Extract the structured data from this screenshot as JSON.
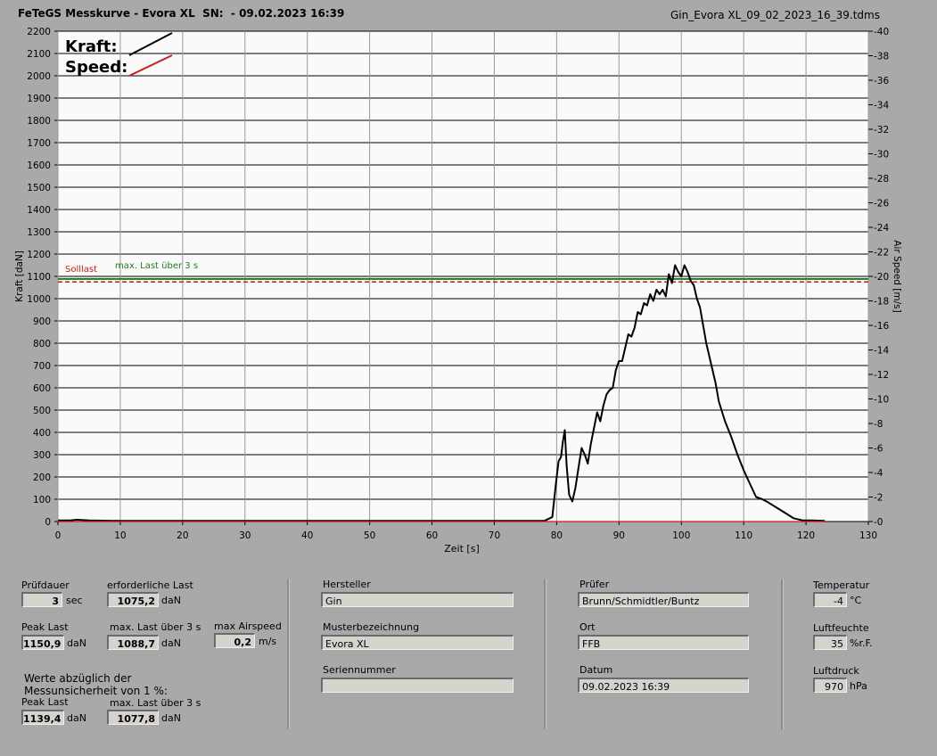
{
  "header": {
    "title": "FeTeGS Messkurve - Evora XL  SN:  - 09.02.2023 16:39",
    "filename": "Gin_Evora XL_09_02_2023_16_39.tdms"
  },
  "chart_data": {
    "type": "line",
    "xlabel": "Zeit [s]",
    "ylabel": "Kraft [daN]",
    "y2label": "Air Speed [m/s]",
    "xlim": [
      0,
      130
    ],
    "ylim": [
      0,
      2200
    ],
    "y2lim": [
      0,
      40
    ],
    "xticks": [
      0,
      10,
      20,
      30,
      40,
      50,
      60,
      70,
      80,
      90,
      100,
      110,
      120,
      130
    ],
    "yticks": [
      0,
      100,
      200,
      300,
      400,
      500,
      600,
      700,
      800,
      900,
      1000,
      1100,
      1200,
      1300,
      1400,
      1500,
      1600,
      1700,
      1800,
      1900,
      2000,
      2100,
      2200
    ],
    "y2ticks": [
      0,
      2,
      4,
      6,
      8,
      10,
      12,
      14,
      16,
      18,
      20,
      22,
      24,
      26,
      28,
      30,
      32,
      34,
      36,
      38,
      40
    ],
    "grid": true,
    "legend": [
      "Kraft:",
      "Speed:"
    ],
    "legend_position": "top-left",
    "series": [
      {
        "name": "Kraft:",
        "color": "#000000",
        "x": [
          0,
          2,
          3,
          5,
          10,
          20,
          30,
          40,
          50,
          60,
          70,
          75,
          78,
          79.3,
          79.8,
          80.3,
          80.7,
          81.0,
          81.3,
          81.6,
          82.0,
          82.5,
          83.0,
          83.6,
          84.0,
          84.5,
          85.0,
          85.5,
          86.0,
          86.5,
          87.0,
          87.5,
          88.0,
          88.5,
          89.0,
          89.5,
          90.0,
          90.5,
          91.0,
          91.5,
          92.0,
          92.5,
          93.0,
          93.5,
          94.0,
          94.5,
          95.0,
          95.5,
          96.0,
          96.5,
          97.0,
          97.5,
          98.0,
          98.5,
          99.0,
          99.5,
          100.0,
          100.5,
          101.0,
          101.5,
          102.0,
          102.5,
          103.0,
          103.5,
          104.0,
          104.5,
          105.0,
          105.5,
          106.0,
          107.0,
          108.0,
          109.0,
          110.0,
          111.0,
          112.0,
          113.0,
          114.0,
          116.0,
          118.0,
          119.5,
          121.0,
          123.0
        ],
        "y": [
          5,
          5,
          8,
          5,
          3,
          3,
          3,
          3,
          3,
          3,
          3,
          3,
          3,
          20,
          150,
          270,
          290,
          360,
          410,
          250,
          120,
          90,
          150,
          260,
          330,
          300,
          260,
          350,
          420,
          490,
          450,
          520,
          570,
          590,
          600,
          680,
          720,
          720,
          780,
          840,
          830,
          870,
          940,
          930,
          980,
          970,
          1020,
          990,
          1040,
          1020,
          1040,
          1010,
          1110,
          1070,
          1150,
          1120,
          1100,
          1150,
          1120,
          1080,
          1060,
          1000,
          960,
          880,
          800,
          740,
          680,
          620,
          540,
          450,
          380,
          300,
          230,
          170,
          110,
          100,
          85,
          50,
          15,
          5,
          5,
          3
        ]
      },
      {
        "name": "Speed:",
        "color": "#cc1b1b",
        "x": [
          0,
          123
        ],
        "y": [
          0,
          0
        ]
      }
    ],
    "reference_lines": [
      {
        "label": "Solllast",
        "value": 1075.2,
        "color": "#cc1b1b",
        "style": "dashed"
      },
      {
        "label": "max. Last über  3 s",
        "value": 1088.7,
        "color": "#1e7b1e",
        "style": "solid"
      }
    ]
  },
  "panel": {
    "pruefdauer_label": "Prüfdauer",
    "pruefdauer_value": "3",
    "pruefdauer_unit": "sec",
    "erf_last_label": "erforderliche Last",
    "erf_last_value": "1075,2",
    "erf_last_unit": "daN",
    "peak_last_label": "Peak Last",
    "peak_last_value": "1150,9",
    "peak_last_unit": "daN",
    "max_last_label": "max. Last über  3 s",
    "max_last_value": "1088,7",
    "max_last_unit": "daN",
    "max_airspeed_label": "max Airspeed",
    "max_airspeed_value": "0,2",
    "max_airspeed_unit": "m/s",
    "werte_line1": "Werte abzüglich der",
    "werte_line2": "Messunsicherheit von 1   %:",
    "peak_last2_label": "Peak Last",
    "peak_last2_value": "1139,4",
    "peak_last2_unit": "daN",
    "max_last2_label": "max. Last über  3 s",
    "max_last2_value": "1077,8",
    "max_last2_unit": "daN",
    "hersteller_label": "Hersteller",
    "hersteller_value": "Gin",
    "muster_label": "Musterbezeichnung",
    "muster_value": "Evora XL",
    "serien_label": "Seriennummer",
    "serien_value": "",
    "pruefer_label": "Prüfer",
    "pruefer_value": "Brunn/Schmidtler/Buntz",
    "ort_label": "Ort",
    "ort_value": "FFB",
    "datum_label": "Datum",
    "datum_value": "09.02.2023 16:39",
    "temp_label": "Temperatur",
    "temp_value": "-4",
    "temp_unit": "°C",
    "feuchte_label": "Luftfeuchte",
    "feuchte_value": "35",
    "feuchte_unit": "%r.F.",
    "druck_label": "Luftdruck",
    "druck_value": "970",
    "druck_unit": "hPa"
  }
}
